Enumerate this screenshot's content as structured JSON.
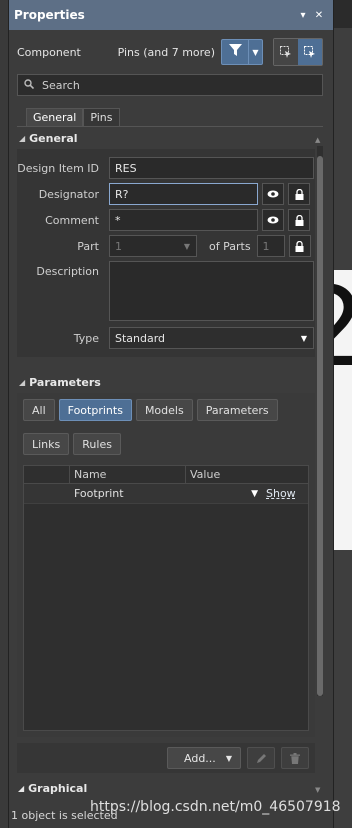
{
  "panel": {
    "title": "Properties",
    "pin_icon": "pin-icon",
    "close_icon": "close-icon"
  },
  "component": {
    "label": "Component",
    "filter_summary": "Pins (and 7 more)"
  },
  "search": {
    "placeholder": "Search"
  },
  "tabs": [
    {
      "label": "General",
      "active": true
    },
    {
      "label": "Pins",
      "active": false
    }
  ],
  "general": {
    "header": "General",
    "design_item_id": {
      "label": "Design Item ID",
      "value": "RES"
    },
    "designator": {
      "label": "Designator",
      "value": "R?"
    },
    "comment": {
      "label": "Comment",
      "value": "*"
    },
    "part": {
      "label": "Part",
      "value": "1",
      "of_parts_label": "of Parts",
      "parts_value": "1"
    },
    "description": {
      "label": "Description",
      "value": ""
    },
    "type": {
      "label": "Type",
      "value": "Standard"
    }
  },
  "parameters": {
    "header": "Parameters",
    "filters": [
      "All",
      "Footprints",
      "Models",
      "Parameters",
      "Links",
      "Rules"
    ],
    "active_filter": "Footprints",
    "columns": {
      "name": "Name",
      "value": "Value"
    },
    "rows": [
      {
        "name": "Footprint",
        "value": "",
        "action": "Show"
      }
    ],
    "add_label": "Add..."
  },
  "graphical": {
    "header": "Graphical"
  },
  "status": {
    "text": "1 object is selected"
  },
  "watermark": "https://blog.csdn.net/m0_46507918",
  "colors": {
    "titlebar": "#5d6f86",
    "accent": "#4e6f95",
    "panel_bg": "#3c3c3c"
  }
}
